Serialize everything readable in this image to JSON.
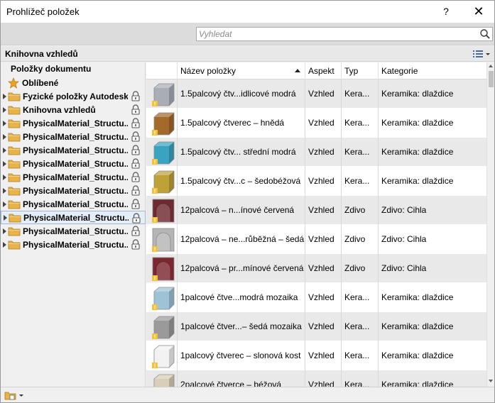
{
  "window": {
    "title": "Prohlížeč položek",
    "help_label": "?",
    "close_label": "✕"
  },
  "search": {
    "placeholder": "Vyhledat",
    "value": ""
  },
  "library_header": {
    "title": "Knihovna vzhledů"
  },
  "sidebar": {
    "document_items": "Položky dokumentu",
    "favorites": "Oblíbené",
    "tree": [
      {
        "label": "Fyzické položky Autodesk",
        "locked": true,
        "selected": false
      },
      {
        "label": "Knihovna vzhledů",
        "locked": true,
        "selected": false
      },
      {
        "label": "PhysicalMaterial_Structu...",
        "locked": true,
        "selected": false
      },
      {
        "label": "PhysicalMaterial_Structu...",
        "locked": true,
        "selected": false
      },
      {
        "label": "PhysicalMaterial_Structu...",
        "locked": true,
        "selected": false
      },
      {
        "label": "PhysicalMaterial_Structu...",
        "locked": true,
        "selected": false
      },
      {
        "label": "PhysicalMaterial_Structu...",
        "locked": true,
        "selected": false
      },
      {
        "label": "PhysicalMaterial_Structu...",
        "locked": true,
        "selected": false
      },
      {
        "label": "PhysicalMaterial_Structu...",
        "locked": true,
        "selected": false
      },
      {
        "label": "PhysicalMaterial_Structu...",
        "locked": true,
        "selected": true
      },
      {
        "label": "PhysicalMaterial_Structu...",
        "locked": true,
        "selected": false
      },
      {
        "label": "PhysicalMaterial_Structu...",
        "locked": true,
        "selected": false
      }
    ]
  },
  "table": {
    "columns": {
      "name": "Název položky",
      "aspect": "Aspekt",
      "type": "Typ",
      "category": "Kategorie"
    },
    "rows": [
      {
        "name": "1.5palcový čtv...idlicové modrá",
        "aspect": "Vzhled",
        "type": "Kera...",
        "category": "Keramika: dlaždice",
        "swatch": "#a9adb6",
        "shape": "cube"
      },
      {
        "name": "1.5palcový čtverec – hnědá",
        "aspect": "Vzhled",
        "type": "Kera...",
        "category": "Keramika: dlaždice",
        "swatch": "#a36a2c",
        "shape": "cube"
      },
      {
        "name": "1.5palcový čtv... střední modrá",
        "aspect": "Vzhled",
        "type": "Kera...",
        "category": "Keramika: dlaždice",
        "swatch": "#3aa3bf",
        "shape": "cube"
      },
      {
        "name": "1.5palcový čtv...c – šedobéžová",
        "aspect": "Vzhled",
        "type": "Kera...",
        "category": "Keramika: dlaždice",
        "swatch": "#bfa13a",
        "shape": "cube"
      },
      {
        "name": "12palcová – n...ínové červená",
        "aspect": "Vzhled",
        "type": "Zdivo",
        "category": "Zdivo: Cihla",
        "swatch": "#6e2a30",
        "shape": "arch"
      },
      {
        "name": "12palcová – ne...růběžná – šedá",
        "aspect": "Vzhled",
        "type": "Zdivo",
        "category": "Zdivo: Cihla",
        "swatch": "#b5b5b5",
        "shape": "arch"
      },
      {
        "name": "12palcová – pr...mínové červená",
        "aspect": "Vzhled",
        "type": "Zdivo",
        "category": "Zdivo: Cihla",
        "swatch": "#7a2730",
        "shape": "arch"
      },
      {
        "name": "1palcové čtve...modrá mozaika",
        "aspect": "Vzhled",
        "type": "Kera...",
        "category": "Keramika: dlaždice",
        "swatch": "#9fc3d6",
        "shape": "cube"
      },
      {
        "name": "1palcové čtver...– šedá mozaika",
        "aspect": "Vzhled",
        "type": "Kera...",
        "category": "Keramika: dlaždice",
        "swatch": "#9a9a9a",
        "shape": "cube"
      },
      {
        "name": "1palcový čtverec – slonová kost",
        "aspect": "Vzhled",
        "type": "Kera...",
        "category": "Keramika: dlaždice",
        "swatch": "#f2f2f2",
        "shape": "cube"
      },
      {
        "name": "2palcové čtverce – béžová",
        "aspect": "Vzhled",
        "type": "Kera...",
        "category": "Keramika: dlaždice",
        "swatch": "#d9cfb8",
        "shape": "cube"
      }
    ]
  },
  "icons": {
    "search": "search-icon",
    "favorites": "star-icon",
    "folder": "folder-icon",
    "lock": "lock-icon",
    "view": "list-view-icon",
    "library": "library-icon",
    "warning": "warning-badge-icon"
  },
  "colors": {
    "accent_star": "#f0a020",
    "folder": "#e8b44a",
    "selected_bg": "#e5edf7"
  }
}
